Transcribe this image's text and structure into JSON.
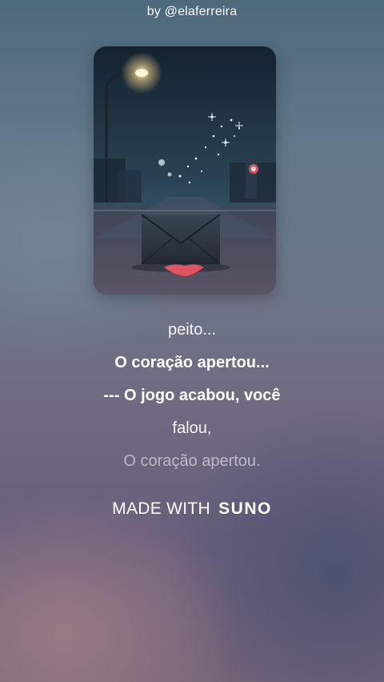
{
  "header": {
    "byline": "by @elaferreira"
  },
  "lyrics": {
    "lines": [
      {
        "text": "peito...",
        "style": "dim"
      },
      {
        "text": "O coração apertou...",
        "style": "bold"
      },
      {
        "text": "---  O jogo acabou, você",
        "style": "bold"
      },
      {
        "text": "falou,",
        "style": "dim"
      },
      {
        "text": "O coração apertou.",
        "style": "fade"
      }
    ]
  },
  "footer": {
    "made_with": "MADE WITH",
    "brand": "SUNO"
  },
  "colors": {
    "cover_sky": "#1f2c3a",
    "heart": "#e0545f",
    "envelope": "#2e3744"
  }
}
